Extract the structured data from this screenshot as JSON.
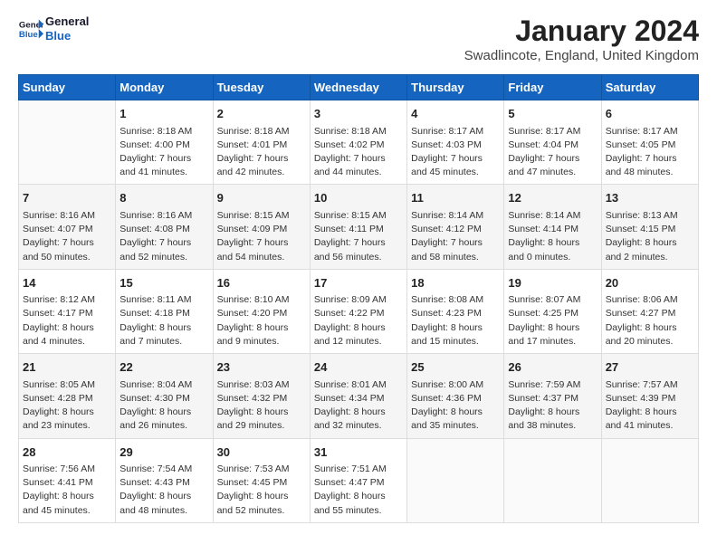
{
  "header": {
    "logo_line1": "General",
    "logo_line2": "Blue",
    "title": "January 2024",
    "subtitle": "Swadlincote, England, United Kingdom"
  },
  "days_of_week": [
    "Sunday",
    "Monday",
    "Tuesday",
    "Wednesday",
    "Thursday",
    "Friday",
    "Saturday"
  ],
  "weeks": [
    [
      {
        "day": "",
        "sunrise": "",
        "sunset": "",
        "daylight": ""
      },
      {
        "day": "1",
        "sunrise": "8:18 AM",
        "sunset": "4:00 PM",
        "daylight": "7 hours and 41 minutes."
      },
      {
        "day": "2",
        "sunrise": "8:18 AM",
        "sunset": "4:01 PM",
        "daylight": "7 hours and 42 minutes."
      },
      {
        "day": "3",
        "sunrise": "8:18 AM",
        "sunset": "4:02 PM",
        "daylight": "7 hours and 44 minutes."
      },
      {
        "day": "4",
        "sunrise": "8:17 AM",
        "sunset": "4:03 PM",
        "daylight": "7 hours and 45 minutes."
      },
      {
        "day": "5",
        "sunrise": "8:17 AM",
        "sunset": "4:04 PM",
        "daylight": "7 hours and 47 minutes."
      },
      {
        "day": "6",
        "sunrise": "8:17 AM",
        "sunset": "4:05 PM",
        "daylight": "7 hours and 48 minutes."
      }
    ],
    [
      {
        "day": "7",
        "sunrise": "8:16 AM",
        "sunset": "4:07 PM",
        "daylight": "7 hours and 50 minutes."
      },
      {
        "day": "8",
        "sunrise": "8:16 AM",
        "sunset": "4:08 PM",
        "daylight": "7 hours and 52 minutes."
      },
      {
        "day": "9",
        "sunrise": "8:15 AM",
        "sunset": "4:09 PM",
        "daylight": "7 hours and 54 minutes."
      },
      {
        "day": "10",
        "sunrise": "8:15 AM",
        "sunset": "4:11 PM",
        "daylight": "7 hours and 56 minutes."
      },
      {
        "day": "11",
        "sunrise": "8:14 AM",
        "sunset": "4:12 PM",
        "daylight": "7 hours and 58 minutes."
      },
      {
        "day": "12",
        "sunrise": "8:14 AM",
        "sunset": "4:14 PM",
        "daylight": "8 hours and 0 minutes."
      },
      {
        "day": "13",
        "sunrise": "8:13 AM",
        "sunset": "4:15 PM",
        "daylight": "8 hours and 2 minutes."
      }
    ],
    [
      {
        "day": "14",
        "sunrise": "8:12 AM",
        "sunset": "4:17 PM",
        "daylight": "8 hours and 4 minutes."
      },
      {
        "day": "15",
        "sunrise": "8:11 AM",
        "sunset": "4:18 PM",
        "daylight": "8 hours and 7 minutes."
      },
      {
        "day": "16",
        "sunrise": "8:10 AM",
        "sunset": "4:20 PM",
        "daylight": "8 hours and 9 minutes."
      },
      {
        "day": "17",
        "sunrise": "8:09 AM",
        "sunset": "4:22 PM",
        "daylight": "8 hours and 12 minutes."
      },
      {
        "day": "18",
        "sunrise": "8:08 AM",
        "sunset": "4:23 PM",
        "daylight": "8 hours and 15 minutes."
      },
      {
        "day": "19",
        "sunrise": "8:07 AM",
        "sunset": "4:25 PM",
        "daylight": "8 hours and 17 minutes."
      },
      {
        "day": "20",
        "sunrise": "8:06 AM",
        "sunset": "4:27 PM",
        "daylight": "8 hours and 20 minutes."
      }
    ],
    [
      {
        "day": "21",
        "sunrise": "8:05 AM",
        "sunset": "4:28 PM",
        "daylight": "8 hours and 23 minutes."
      },
      {
        "day": "22",
        "sunrise": "8:04 AM",
        "sunset": "4:30 PM",
        "daylight": "8 hours and 26 minutes."
      },
      {
        "day": "23",
        "sunrise": "8:03 AM",
        "sunset": "4:32 PM",
        "daylight": "8 hours and 29 minutes."
      },
      {
        "day": "24",
        "sunrise": "8:01 AM",
        "sunset": "4:34 PM",
        "daylight": "8 hours and 32 minutes."
      },
      {
        "day": "25",
        "sunrise": "8:00 AM",
        "sunset": "4:36 PM",
        "daylight": "8 hours and 35 minutes."
      },
      {
        "day": "26",
        "sunrise": "7:59 AM",
        "sunset": "4:37 PM",
        "daylight": "8 hours and 38 minutes."
      },
      {
        "day": "27",
        "sunrise": "7:57 AM",
        "sunset": "4:39 PM",
        "daylight": "8 hours and 41 minutes."
      }
    ],
    [
      {
        "day": "28",
        "sunrise": "7:56 AM",
        "sunset": "4:41 PM",
        "daylight": "8 hours and 45 minutes."
      },
      {
        "day": "29",
        "sunrise": "7:54 AM",
        "sunset": "4:43 PM",
        "daylight": "8 hours and 48 minutes."
      },
      {
        "day": "30",
        "sunrise": "7:53 AM",
        "sunset": "4:45 PM",
        "daylight": "8 hours and 52 minutes."
      },
      {
        "day": "31",
        "sunrise": "7:51 AM",
        "sunset": "4:47 PM",
        "daylight": "8 hours and 55 minutes."
      },
      {
        "day": "",
        "sunrise": "",
        "sunset": "",
        "daylight": ""
      },
      {
        "day": "",
        "sunrise": "",
        "sunset": "",
        "daylight": ""
      },
      {
        "day": "",
        "sunrise": "",
        "sunset": "",
        "daylight": ""
      }
    ]
  ],
  "labels": {
    "sunrise_prefix": "Sunrise: ",
    "sunset_prefix": "Sunset: ",
    "daylight_prefix": "Daylight: "
  }
}
